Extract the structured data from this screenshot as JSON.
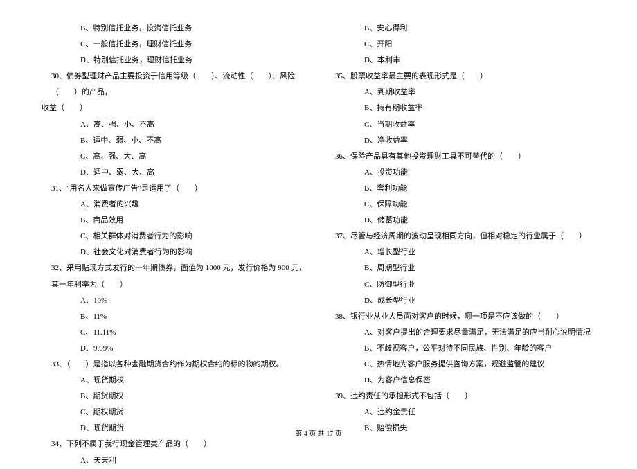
{
  "left_column": {
    "q29_options": [
      "B、特别信托业务，投资信托业务",
      "C、一般信托业务，理财信托业务",
      "D、特别信托业务，理财信托业务"
    ],
    "q30": {
      "line1": "30、债券型理财产品主要投资于信用等级（　　）、流动性（　　）、风险（　　）的产品，",
      "line2": "收益（　　）",
      "options": [
        "A、高、强、小、不高",
        "B、适中、弱、小、不高",
        "C、高、强、大、高",
        "D、适中、弱、大、高"
      ]
    },
    "q31": {
      "prompt": "31、\"用名人来做宣传广告\"是运用了（　　）",
      "options": [
        "A、消费者的兴趣",
        "B、商品效用",
        "C、相关群体对消费者行为的影响",
        "D、社会文化对消费者行为的影响"
      ]
    },
    "q32": {
      "prompt": "32、采用贴现方式发行的一年期债券，面值为 1000 元，发行价格为 900 元，其一年利率为（　　）",
      "options": [
        "A、10%",
        "B、11%",
        "C、11.11%",
        "D、9.99%"
      ]
    },
    "q33": {
      "prompt": "33、（　　）是指以各种金融期货合约作为期权合约的标的物的期权。",
      "options": [
        "A、现货期权",
        "B、期货期权",
        "C、期权期货",
        "D、现货期货"
      ]
    },
    "q34": {
      "prompt": "34、下列不属于我行现金管理类产品的（　　）",
      "options": [
        "A、天天利"
      ]
    }
  },
  "right_column": {
    "q34_options_cont": [
      "B、安心得利",
      "C、开阳",
      "D、本利丰"
    ],
    "q35": {
      "prompt": "35、股票收益率最主要的表现形式是（　　）",
      "options": [
        "A、到期收益率",
        "B、持有期收益率",
        "C、当期收益率",
        "D、净收益率"
      ]
    },
    "q36": {
      "prompt": "36、保险产品具有其他投资理财工具不可替代的（　　）",
      "options": [
        "A、投资功能",
        "B、套利功能",
        "C、保障功能",
        "D、储蓄功能"
      ]
    },
    "q37": {
      "prompt": "37、尽管与经济周期的波动呈现相同方向，但相对稳定的行业属于（　　）",
      "options": [
        "A、增长型行业",
        "B、周期型行业",
        "C、防御型行业",
        "D、成长型行业"
      ]
    },
    "q38": {
      "prompt": "38、银行业从业人员面对客户的时候，哪一项是不应该做的（　　）",
      "options": [
        "A、对客户提出的合理要求尽量满足，无法满足的应当耐心说明情况",
        "B、不歧视客户，公平对待不同民族、性别、年龄的客户",
        "C、热情地为客户服务提供咨询方案，规避监管的建议",
        "D、为客户信息保密"
      ]
    },
    "q39": {
      "prompt": "39、违约责任的承担形式不包括（　　）",
      "options": [
        "A、违约金责任",
        "B、赔偿损失"
      ]
    }
  },
  "footer": "第 4 页 共 17 页"
}
